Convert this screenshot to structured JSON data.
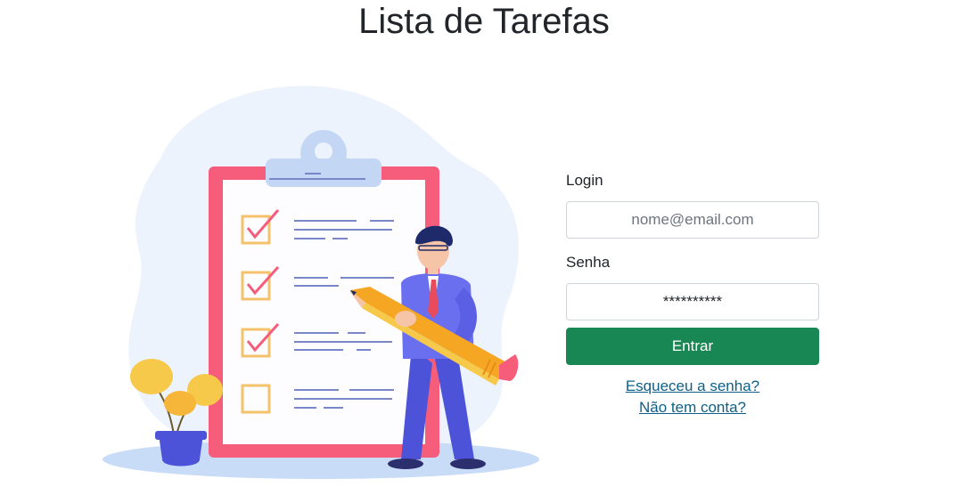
{
  "page": {
    "title": "Lista de Tarefas"
  },
  "illustration": {
    "name": "checklist-illustration"
  },
  "login_form": {
    "login_label": "Login",
    "login_placeholder": "nome@email.com",
    "password_label": "Senha",
    "password_value": "**********",
    "submit_label": "Entrar",
    "forgot_password_link": "Esqueceu a senha?",
    "signup_link": "Não tem conta?"
  },
  "colors": {
    "primary_button": "#198754",
    "link": "#0d5f87",
    "clipboard_frame": "#f55d7b",
    "character_suit": "#4d53d8",
    "pencil": "#f5a623"
  }
}
